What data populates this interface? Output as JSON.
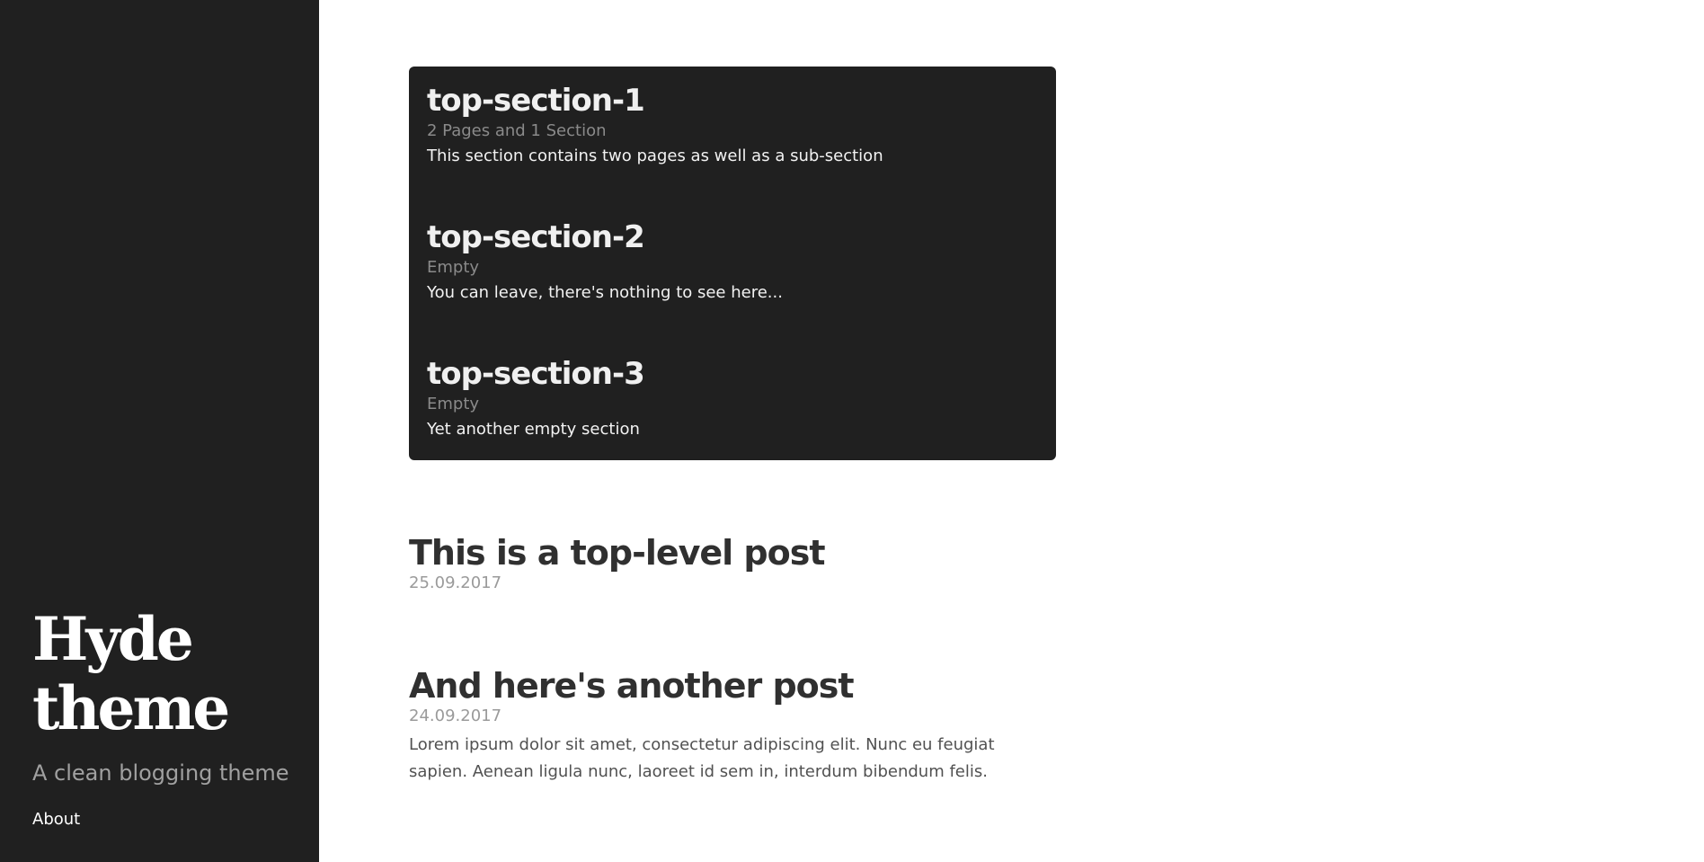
{
  "sidebar": {
    "title": "Hyde\ntheme",
    "tagline": "A clean blogging theme",
    "nav": [
      {
        "label": "About"
      }
    ]
  },
  "sections": [
    {
      "title": "top-section-1",
      "meta": "2 Pages and 1 Section",
      "description": "This section contains two pages as well as a sub-section"
    },
    {
      "title": "top-section-2",
      "meta": "Empty",
      "description": "You can leave, there's nothing to see here..."
    },
    {
      "title": "top-section-3",
      "meta": "Empty",
      "description": "Yet another empty section"
    }
  ],
  "posts": [
    {
      "title": "This is a top-level post",
      "date": "25.09.2017",
      "excerpt": ""
    },
    {
      "title": "And here's another post",
      "date": "24.09.2017",
      "excerpt": "Lorem ipsum dolor sit amet, consectetur adipiscing elit. Nunc eu feugiat sapien. Aenean ligula nunc, laoreet id sem in, interdum bibendum felis."
    }
  ],
  "colors": {
    "sidebar_bg": "#202020",
    "section_box_bg": "#202020",
    "page_bg": "#ffffff",
    "muted_text": "#8a8a8a"
  }
}
